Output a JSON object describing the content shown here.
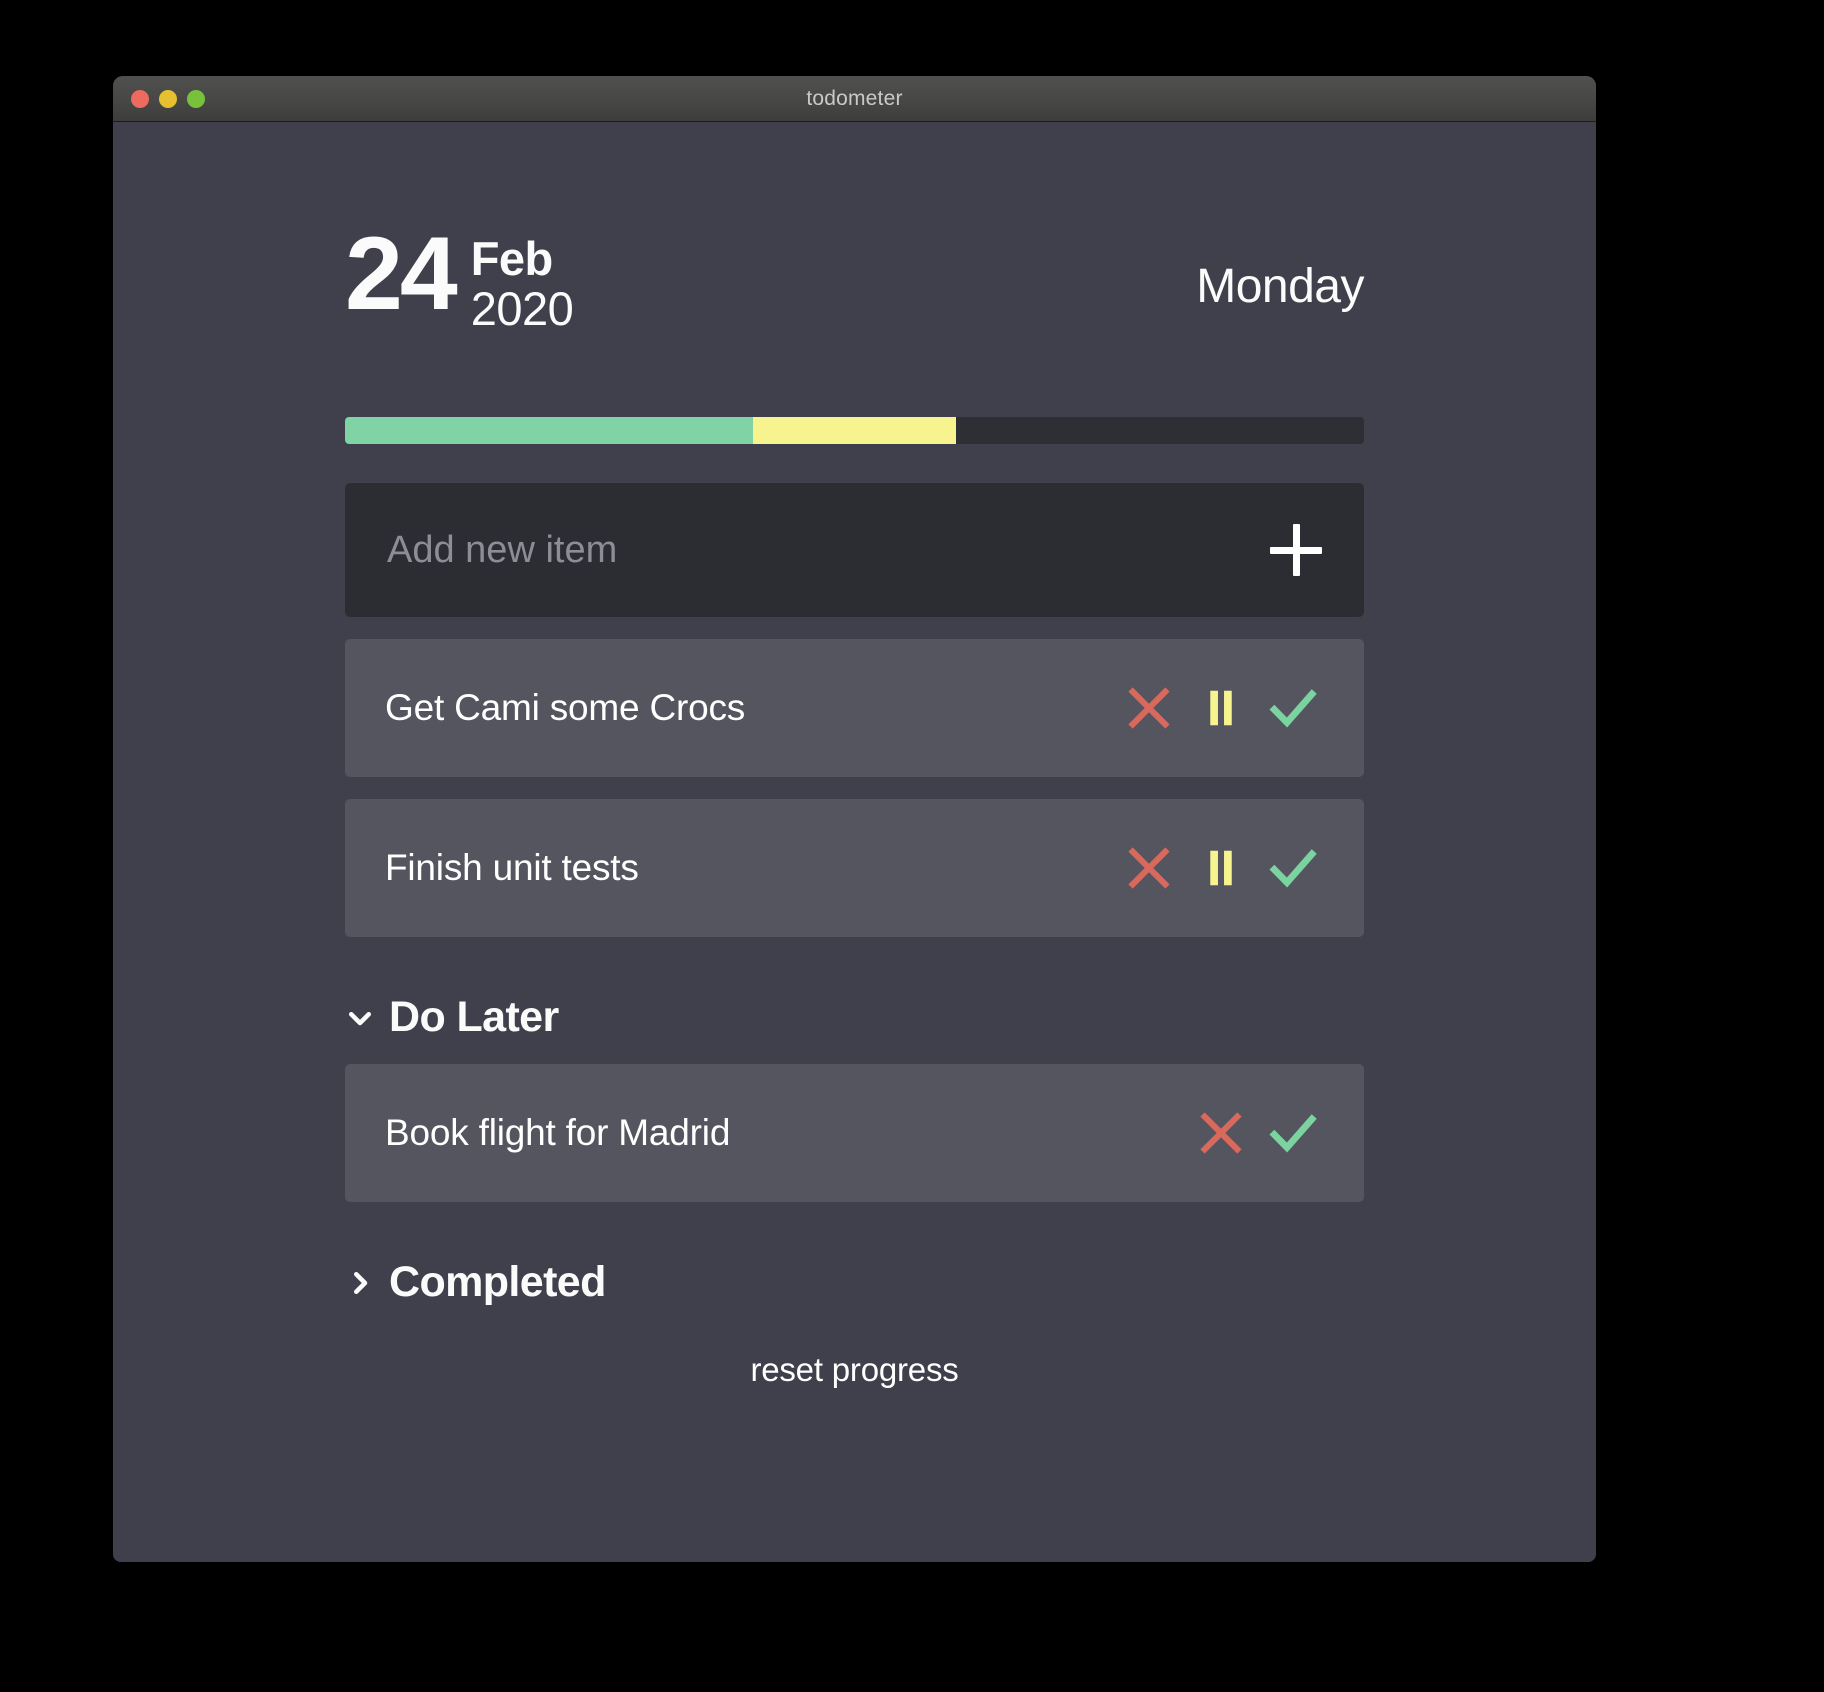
{
  "window": {
    "title": "todometer",
    "traffic_lights": [
      {
        "name": "close",
        "color": "#ec6a5f"
      },
      {
        "name": "minimize",
        "color": "#e6c02f"
      },
      {
        "name": "maximize",
        "color": "#78c13d"
      }
    ]
  },
  "header": {
    "day": "24",
    "month": "Feb",
    "year": "2020",
    "weekday": "Monday"
  },
  "progress": {
    "completed_percent": 40,
    "paused_percent": 20,
    "remaining_percent": 40,
    "completed_color": "#80d3a4",
    "paused_color": "#f7f490",
    "track_color": "#2e2e35"
  },
  "add": {
    "placeholder": "Add new item",
    "value": "",
    "button_icon": "plus-icon"
  },
  "actions": {
    "remove_label": "✕",
    "pause_label": "❚❚",
    "complete_label": "✓",
    "remove_color": "#d9695c",
    "pause_color": "#f7f490",
    "complete_color": "#7bd3a0"
  },
  "tasks": [
    {
      "label": "Get Cami some Crocs",
      "has_pause": true
    },
    {
      "label": "Finish unit tests",
      "has_pause": true
    }
  ],
  "sections": [
    {
      "title": "Do Later",
      "expanded": true,
      "chevron": "chevron-down-icon",
      "items": [
        {
          "label": "Book flight for Madrid",
          "has_pause": false
        }
      ]
    },
    {
      "title": "Completed",
      "expanded": false,
      "chevron": "chevron-right-icon",
      "items": []
    }
  ],
  "footer": {
    "reset_label": "reset progress"
  }
}
